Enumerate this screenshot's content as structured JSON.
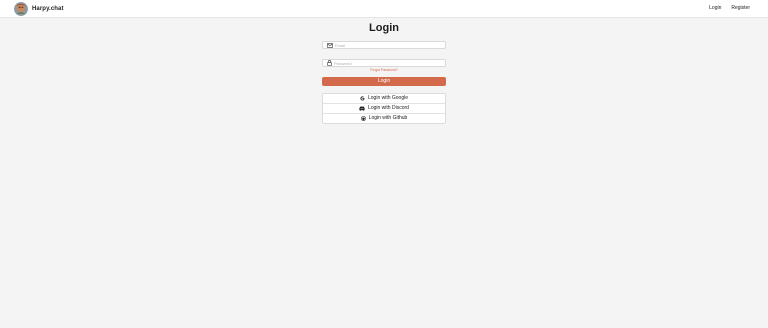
{
  "header": {
    "brand_name": "Harpy.chat",
    "nav": {
      "login_label": "Login",
      "register_label": "Register"
    }
  },
  "login_form": {
    "title": "Login",
    "email": {
      "placeholder": "Email",
      "value": ""
    },
    "password": {
      "placeholder": "Password",
      "value": ""
    },
    "forgot_password_label": "Forgot Password?",
    "submit_label": "Login",
    "oauth": {
      "google_label": "Login with Google",
      "discord_label": "Login with Discord",
      "github_label": "Login with Github"
    }
  },
  "icons": {
    "email": "mail-icon",
    "password": "lock-icon",
    "google": "google-icon",
    "discord": "discord-icon",
    "github": "github-icon"
  },
  "colors": {
    "page_background": "#f4f4f4",
    "header_background": "#ffffff",
    "primary_button": "#d46a4c",
    "link_accent": "#d96a52"
  }
}
